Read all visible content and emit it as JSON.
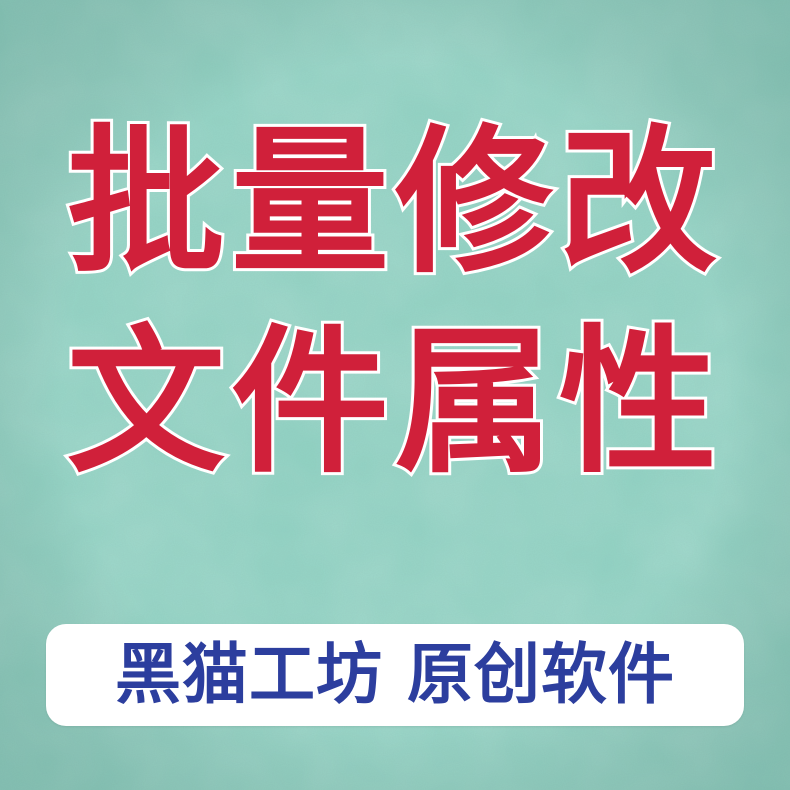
{
  "title": {
    "line1": "批量修改",
    "line2": "文件属性"
  },
  "badge": {
    "text": "黑猫工坊 原创软件"
  },
  "colors": {
    "background": "#8fd2c2",
    "title": "#d0203a",
    "title_outline": "#ffffff",
    "badge_background": "#ffffff",
    "badge_text": "#2c3e9e"
  }
}
